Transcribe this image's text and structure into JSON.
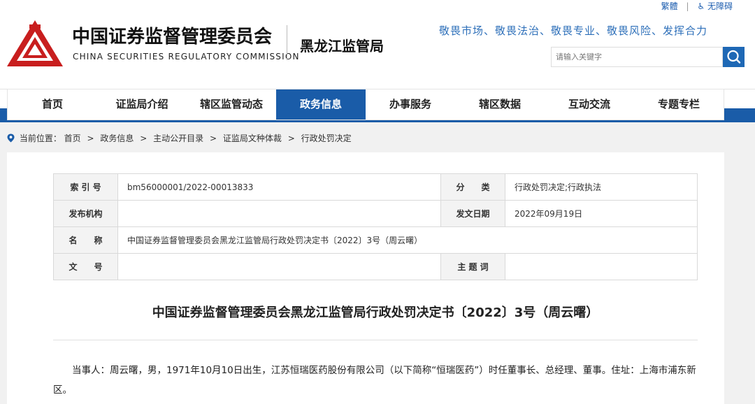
{
  "header": {
    "org_cn": "中国证券监督管理委员会",
    "org_en": "CHINA SECURITIES REGULATORY COMMISSION",
    "bureau": "黑龙江监管局",
    "slogan": "敬畏市场、敬畏法治、敬畏专业、敬畏风险、发挥合力",
    "links": {
      "traditional": "繁體",
      "accessibility": "无障碍"
    },
    "search": {
      "placeholder": "请输入关键字"
    },
    "brand_color": "#c41e1e",
    "accent_color": "#1a5ca8"
  },
  "nav": {
    "items": [
      {
        "label": "首页"
      },
      {
        "label": "证监局介绍"
      },
      {
        "label": "辖区监管动态"
      },
      {
        "label": "政务信息"
      },
      {
        "label": "办事服务"
      },
      {
        "label": "辖区数据"
      },
      {
        "label": "互动交流"
      },
      {
        "label": "专题专栏"
      }
    ],
    "active": "政务信息"
  },
  "breadcrumb": {
    "prefix": "当前位置：",
    "items": [
      "首页",
      "政务信息",
      "主动公开目录",
      "证监局文种体裁",
      "行政处罚决定"
    ],
    "separator": ">"
  },
  "meta": {
    "index_label": "索 引 号",
    "index_value": "bm56000001/2022-00013833",
    "category_label": "分　　类",
    "category_value": "行政处罚决定;行政执法",
    "publisher_label": "发布机构",
    "publisher_value": "",
    "date_label": "发文日期",
    "date_value": "2022年09月19日",
    "name_label": "名　　称",
    "name_value": "中国证券监督管理委员会黑龙江监管局行政处罚决定书〔2022〕3号（周云曙）",
    "docno_label": "文　　号",
    "docno_value": "",
    "subject_label": "主 题 词",
    "subject_value": ""
  },
  "document": {
    "title": "中国证券监督管理委员会黑龙江监管局行政处罚决定书〔2022〕3号（周云曙）",
    "paragraph": "当事人：周云曙，男，1971年10月10日出生，江苏恒瑞医药股份有限公司（以下简称“恒瑞医药”）时任董事长、总经理、董事。住址：上海市浦东新区。"
  }
}
